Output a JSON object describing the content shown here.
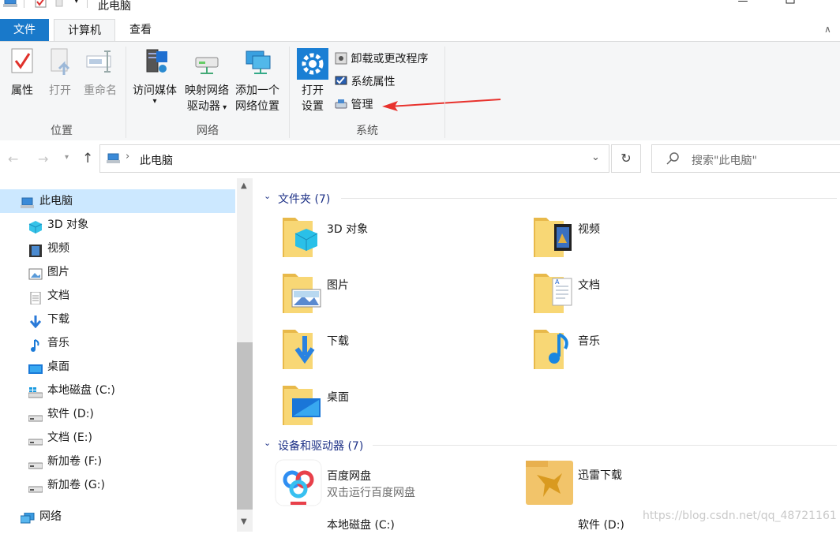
{
  "window": {
    "title": "此电脑"
  },
  "tabs": {
    "file": "文件",
    "computer": "计算机",
    "view": "查看"
  },
  "ribbon": {
    "location": {
      "label": "位置",
      "properties": "属性",
      "open": "打开",
      "rename": "重命名"
    },
    "network": {
      "label": "网络",
      "access_media": "访问媒体",
      "map_drive_1": "映射网络",
      "map_drive_2": "驱动器",
      "add_location_1": "添加一个",
      "add_location_2": "网络位置"
    },
    "system": {
      "label": "系统",
      "open_settings_1": "打开",
      "open_settings_2": "设置",
      "uninstall": "卸载或更改程序",
      "sys_props": "系统属性",
      "manage": "管理"
    }
  },
  "address": {
    "path": "此电脑",
    "search_placeholder": "搜索\"此电脑\""
  },
  "sidebar": {
    "items": [
      {
        "label": "此电脑",
        "icon": "computer-icon",
        "selected": true
      },
      {
        "label": "3D 对象",
        "icon": "cube-icon"
      },
      {
        "label": "视频",
        "icon": "video-icon"
      },
      {
        "label": "图片",
        "icon": "picture-icon"
      },
      {
        "label": "文档",
        "icon": "document-icon"
      },
      {
        "label": "下载",
        "icon": "download-icon"
      },
      {
        "label": "音乐",
        "icon": "music-icon"
      },
      {
        "label": "桌面",
        "icon": "desktop-icon"
      },
      {
        "label": "本地磁盘 (C:)",
        "icon": "windows-drive-icon"
      },
      {
        "label": "软件 (D:)",
        "icon": "drive-icon"
      },
      {
        "label": "文档 (E:)",
        "icon": "drive-icon"
      },
      {
        "label": "新加卷 (F:)",
        "icon": "drive-icon"
      },
      {
        "label": "新加卷 (G:)",
        "icon": "drive-icon"
      },
      {
        "label": "网络",
        "icon": "network-icon"
      }
    ]
  },
  "content": {
    "folders_header": "文件夹 (7)",
    "folders": [
      "3D 对象",
      "视频",
      "图片",
      "文档",
      "下载",
      "音乐",
      "桌面"
    ],
    "devices_header": "设备和驱动器 (7)",
    "devices": [
      {
        "label": "百度网盘",
        "sub": "双击运行百度网盘"
      },
      {
        "label": "迅雷下载",
        "sub": ""
      },
      {
        "label": "本地磁盘 (C:)",
        "sub": ""
      },
      {
        "label": "软件 (D:)",
        "sub": ""
      }
    ]
  },
  "watermark": "https://blog.csdn.net/qq_48721161",
  "colors": {
    "accent": "#1979ca",
    "folder": "#f8d775",
    "arrow": "#e8322d"
  }
}
